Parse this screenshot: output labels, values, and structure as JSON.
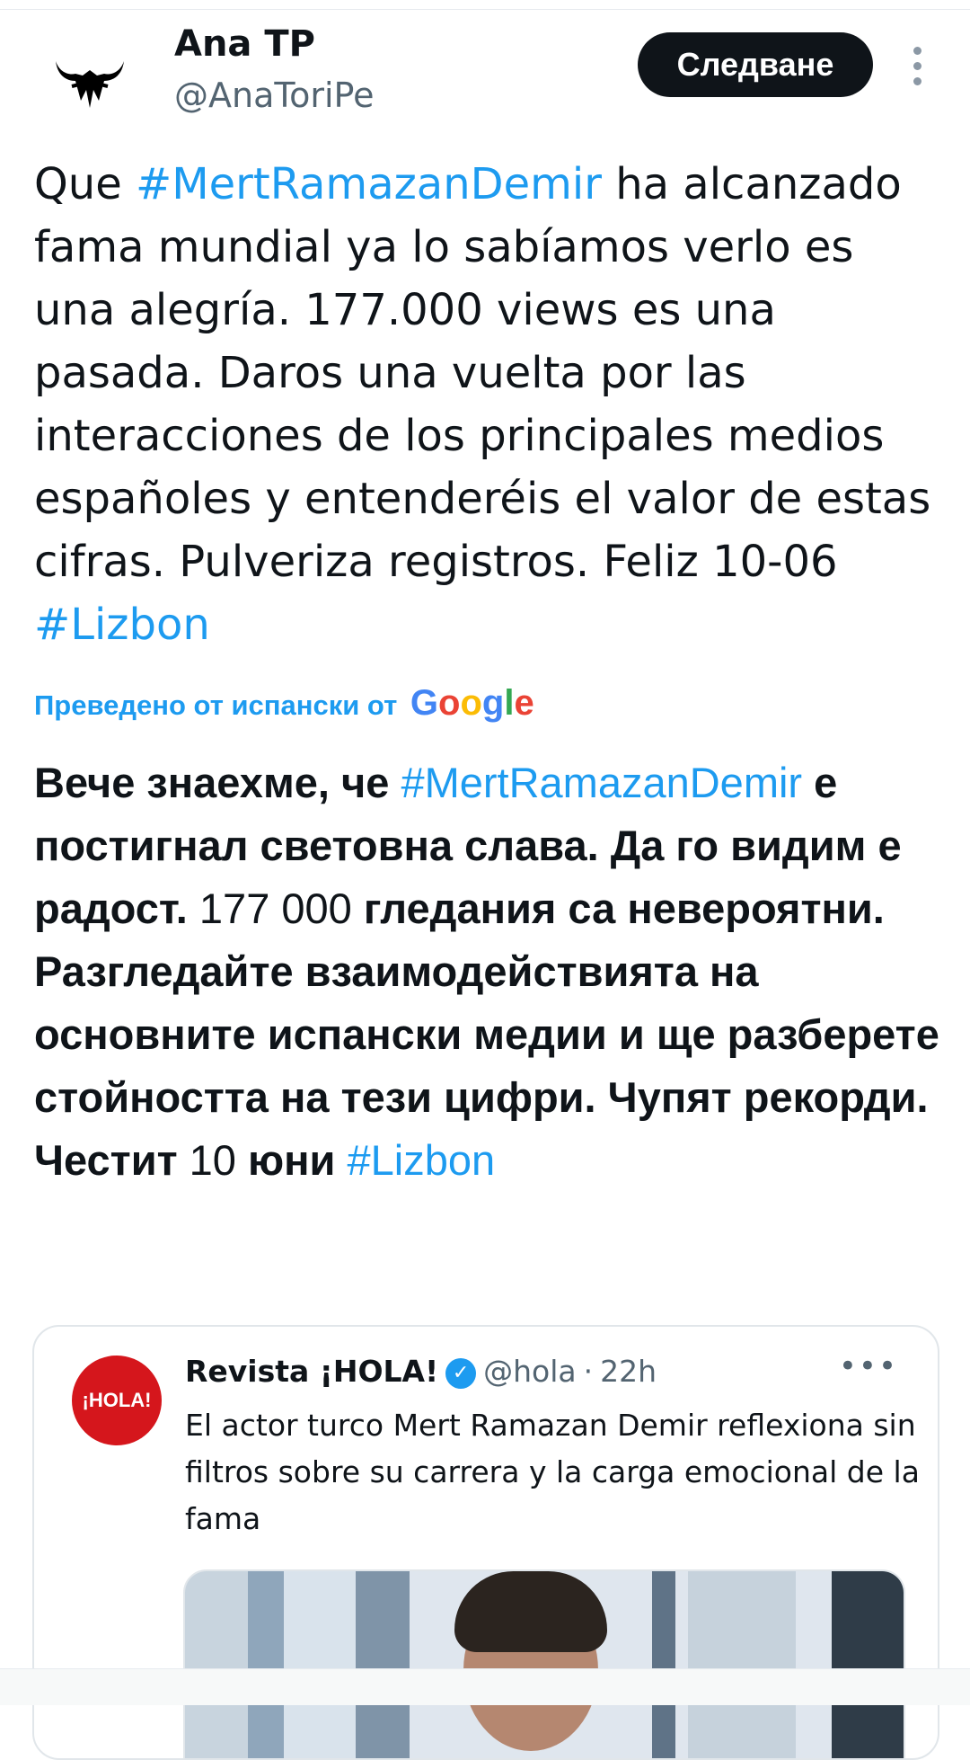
{
  "tweet": {
    "author_name": "Ana TP",
    "author_handle": "@AnaToriPe",
    "follow_label": "Следване",
    "text_parts": [
      "Que ",
      "#MertRamazanDemir",
      " ha alcanzado fama mundial ya lo sabíamos verlo es una alegría. 177.000 views es una pasada. Daros una vuelta por las interacciones de los principales medios españoles y entenderéis el valor de estas cifras. Pulveriza registros. Feliz 10-06 ",
      "#Lizbon"
    ],
    "translated_by": "Преведено от испански от",
    "translator_brand": "Google",
    "translation_parts": [
      "Вече знаехме, че ",
      "#MertRamazanDemir",
      " е постигнал световна слава. Да го видим е радост. ",
      "177 000",
      " гледания са невероятни. Разгледайте взаимодействията на основните испански медии и ще разберете стойността на тези цифри. Чупят рекорди. Честит ",
      "10",
      " юни ",
      "#Lizbon"
    ]
  },
  "quoted": {
    "logo_text": "¡HOLA!",
    "name": "Revista ¡HOLA!",
    "handle": "@hola",
    "time": "22h",
    "text": "El actor turco Mert Ramazan Demir reflexiona sin filtros sobre su carrera y la carga emocional de la fama"
  },
  "colors": {
    "link": "#1d9bf0",
    "text": "#0f1419",
    "muted": "#536471",
    "follow_bg": "#0f1419",
    "hola_red": "#d5161c"
  },
  "icons": [
    "bull-logo-icon",
    "more-options-icon",
    "verified-icon",
    "google-logo-icon"
  ]
}
